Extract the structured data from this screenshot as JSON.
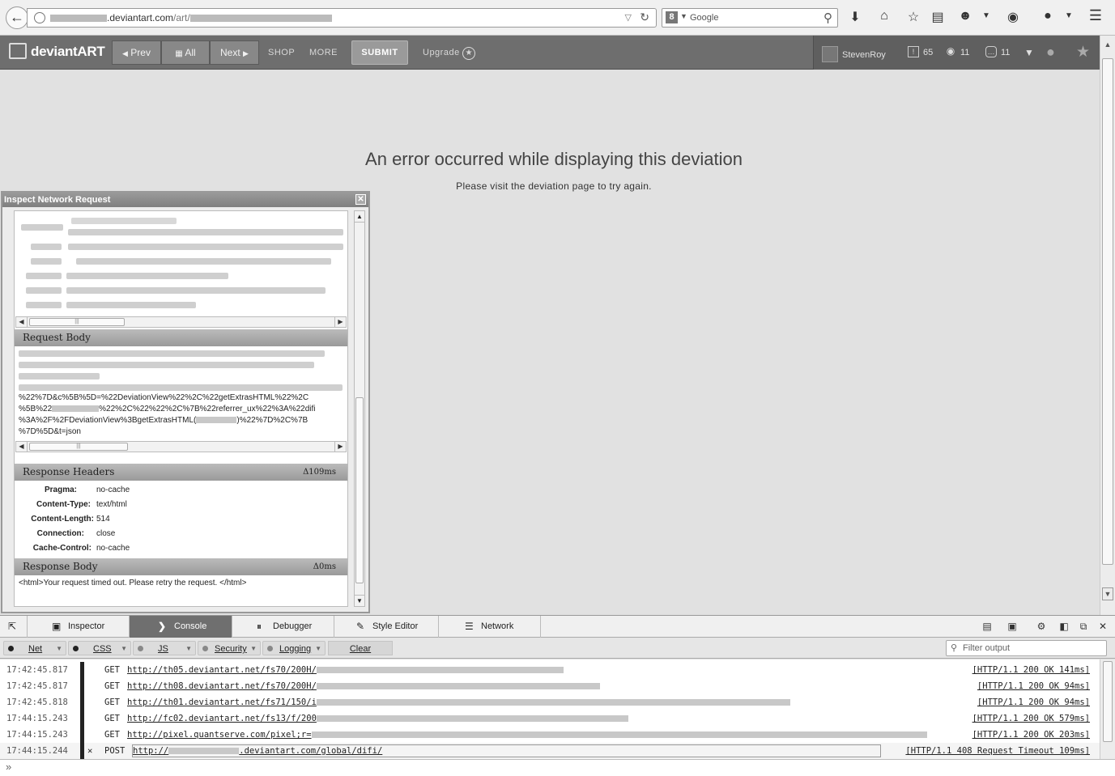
{
  "browser": {
    "url_host": "deviantart.com",
    "url_path": "/art/",
    "search_placeholder": "Google",
    "search_engine_letter": "8"
  },
  "header": {
    "logo_text": "deviantART",
    "prev_label": "Prev",
    "all_label": "All",
    "next_label": "Next",
    "shop_label": "SHOP",
    "more_label": "MORE",
    "submit_label": "SUBMIT",
    "upgrade_label": "Upgrade",
    "username": "StevenRoy",
    "notif_count": "65",
    "watch_count": "11",
    "comment_count": "11"
  },
  "error": {
    "title": "An error occurred while displaying this deviation",
    "subtitle": "Please visit the deviation page to try again."
  },
  "inspect": {
    "window_title": "Inspect Network Request",
    "request_body_label": "Request Body",
    "request_body_lines": [
      "%22%7D&c%5B%5D=%22DeviationView%22%2C%22getExtrasHTML%22%2C",
      "%5B%22",
      "%22%2C%22%22%2C%7B%22referrer_ux%22%3A%22difi",
      "%3A%2F%2FDeviationView%3BgetExtrasHTML(",
      ")%22%7D%2C%7B",
      "%7D%5D&t=json"
    ],
    "response_headers_label": "Response Headers",
    "response_headers_delta": "Δ109ms",
    "headers": [
      {
        "key": "Pragma:",
        "value": "no-cache"
      },
      {
        "key": "Content-Type:",
        "value": "text/html"
      },
      {
        "key": "Content-Length:",
        "value": "514"
      },
      {
        "key": "Connection:",
        "value": "close"
      },
      {
        "key": "Cache-Control:",
        "value": "no-cache"
      }
    ],
    "response_body_label": "Response Body",
    "response_body_delta": "Δ0ms",
    "response_body_text": "<html>Your request timed out. Please retry the request. </html>"
  },
  "devtools": {
    "tabs": [
      {
        "label": "Inspector",
        "icon": "inspector-icon"
      },
      {
        "label": "Console",
        "icon": "console-icon"
      },
      {
        "label": "Debugger",
        "icon": "debugger-icon"
      },
      {
        "label": "Style Editor",
        "icon": "style-editor-icon"
      },
      {
        "label": "Network",
        "icon": "network-icon"
      }
    ],
    "filters": [
      "Net",
      "CSS",
      "JS",
      "Security",
      "Logging"
    ],
    "clear_label": "Clear",
    "filter_placeholder": "Filter output",
    "log": [
      {
        "time": "17:42:45.817",
        "method": "GET",
        "url": "http://th05.deviantart.net/fs70/200H/",
        "status": "[HTTP/1.1 200 OK 141ms]"
      },
      {
        "time": "17:42:45.817",
        "method": "GET",
        "url": "http://th08.deviantart.net/fs70/200H/",
        "status": "[HTTP/1.1 200 OK 94ms]"
      },
      {
        "time": "17:42:45.818",
        "method": "GET",
        "url": "http://th01.deviantart.net/fs71/150/i",
        "status": "[HTTP/1.1 200 OK 94ms]"
      },
      {
        "time": "17:44:15.243",
        "method": "GET",
        "url": "http://fc02.deviantart.net/fs13/f/200",
        "status": "[HTTP/1.1 200 OK 579ms]"
      },
      {
        "time": "17:44:15.243",
        "method": "GET",
        "url": "http://pixel.quantserve.com/pixel;r=",
        "status": "[HTTP/1.1 200 OK 203ms]"
      },
      {
        "time": "17:44:15.244",
        "method": "POST",
        "url_prefix": "http://",
        "url_suffix": ".deviantart.com/global/difi/",
        "status": "[HTTP/1.1 408 Request Timeout 109ms]"
      }
    ]
  }
}
